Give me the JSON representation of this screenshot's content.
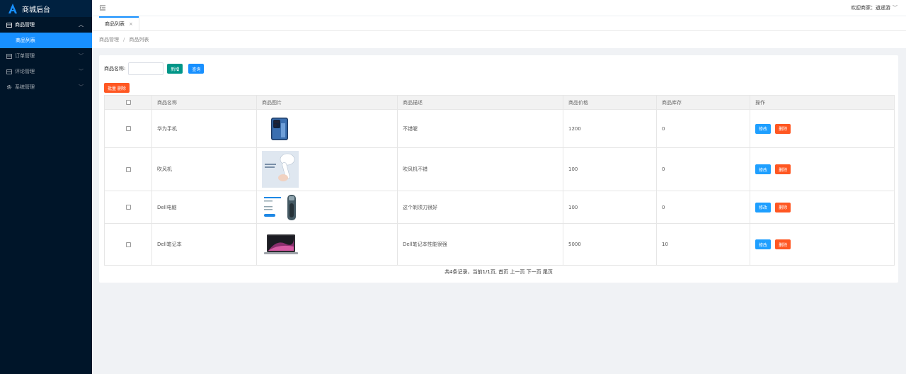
{
  "app": {
    "title": "商城后台"
  },
  "sidebar": {
    "menus": [
      {
        "label": "商品管理",
        "open": true,
        "icon": "grid-icon",
        "children": [
          {
            "label": "商品列表",
            "active": true
          }
        ]
      },
      {
        "label": "订单管理",
        "icon": "grid-icon"
      },
      {
        "label": "评论管理",
        "icon": "grid-icon"
      },
      {
        "label": "系统管理",
        "icon": "gear-icon"
      }
    ]
  },
  "header": {
    "welcome": "欢迎商家：逍遥游"
  },
  "tabs": [
    {
      "label": "商品列表",
      "close": "×"
    }
  ],
  "breadcrumb": {
    "items": [
      "商品管理",
      "商品列表"
    ],
    "separator": "/"
  },
  "search": {
    "label": "商品名称:",
    "value": "",
    "add_label": "新增",
    "query_label": "查询"
  },
  "batch_delete_label": "批量 删除",
  "table": {
    "columns": [
      "商品名称",
      "商品图片",
      "商品描述",
      "商品价格",
      "商品库存",
      "操作"
    ],
    "rows": [
      {
        "name": "华为手机",
        "image": "phone-image",
        "desc": "不错喔",
        "price": "1200",
        "stock": "0"
      },
      {
        "name": "吹风机",
        "image": "hair-dryer-image",
        "desc": "吹风机不错",
        "price": "100",
        "stock": "0"
      },
      {
        "name": "Dell电脑",
        "image": "shaver-image",
        "desc": "这个剃须刀很好",
        "price": "100",
        "stock": "0"
      },
      {
        "name": "Dell笔记本",
        "image": "laptop-image",
        "desc": "Dell笔记本性能很强",
        "price": "5000",
        "stock": "10"
      }
    ],
    "edit_label": "修改",
    "delete_label": "删除"
  },
  "pager": {
    "text": "共4条记录，当前1/1页, 首页 上一页 下一页 尾页"
  },
  "colors": {
    "sidebar": "#001529",
    "active": "#1890ff",
    "add": "#009688",
    "danger": "#ff5722",
    "edit": "#1e9fff"
  }
}
